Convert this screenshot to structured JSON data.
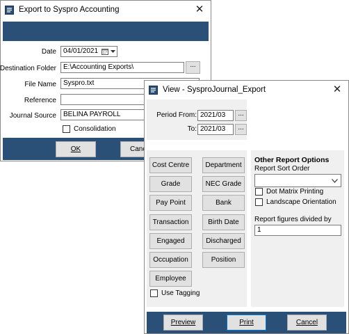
{
  "export_dialog": {
    "title": "Export to Syspro Accounting",
    "date_label": "Date",
    "date_value": "04/01/2021",
    "destination_label": "Destination Folder",
    "destination_value": "E:\\Accounting Exports\\",
    "browse_label": "...",
    "file_name_label": "File Name",
    "file_name_value": "Syspro.txt",
    "reference_label": "Reference",
    "reference_value": "",
    "journal_source_label": "Journal Source",
    "journal_source_value": "BELINA PAYROLL",
    "consolidation_label": "Consolidation",
    "ok_label": "OK",
    "cancel_label": "Cance"
  },
  "view_dialog": {
    "title": "View - SysproJournal_Export",
    "period_from_label": "Period From:",
    "period_from_value": "2021/03",
    "period_to_label": "To:",
    "period_to_value": "2021/03",
    "period_btn_label": "...",
    "grouping_buttons_left": [
      "Cost Centre",
      "Grade",
      "Pay Point",
      "Transaction",
      "Engaged",
      "Occupation",
      "Employee"
    ],
    "grouping_buttons_right": [
      "Department",
      "NEC Grade",
      "Bank",
      "Birth Date",
      "Discharged",
      "Position"
    ],
    "use_tagging_label": "Use Tagging",
    "other_options_heading": "Other Report Options",
    "sort_order_label": "Report Sort Order",
    "sort_order_value": "",
    "dot_matrix_label": "Dot Matrix Printing",
    "landscape_label": "Landscape Orientation",
    "figures_divided_label": "Report figures divided by",
    "figures_divided_value": "1",
    "preview_label": "Preview",
    "print_label": "Print",
    "cancel_label": "Cancel"
  },
  "colors": {
    "banner": "#2b5077",
    "panel": "#f0f0f0",
    "button": "#e1e1e1"
  }
}
